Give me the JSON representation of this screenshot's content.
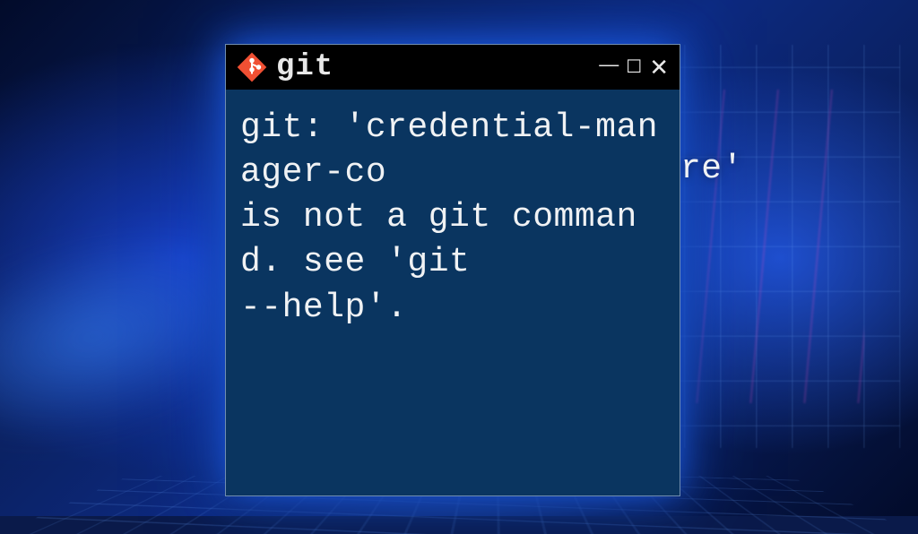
{
  "window": {
    "title": "git",
    "icon_name": "git-icon"
  },
  "terminal": {
    "output": "git: 'credential-manager-co\nis not a git command. see 'git\n--help'."
  },
  "overflow": {
    "text": "re'"
  },
  "colors": {
    "titlebar_bg": "#000000",
    "terminal_bg": "#0a3560",
    "text_color": "#f0f2f4",
    "git_icon_color": "#f05033"
  }
}
